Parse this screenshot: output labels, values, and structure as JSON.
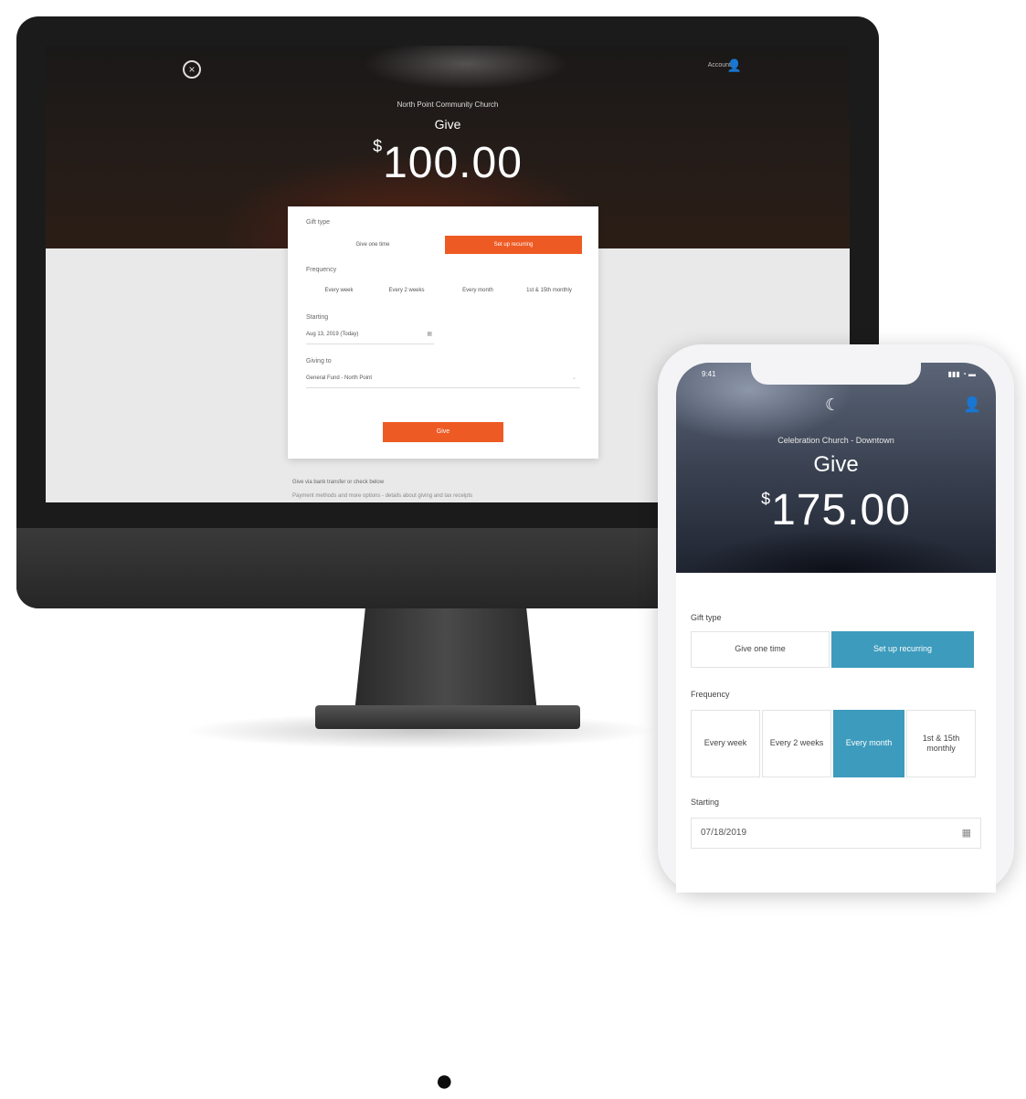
{
  "desktop": {
    "close_icon": "close-icon",
    "login_label": "Account",
    "church_name": "North Point Community Church",
    "give_title": "Give",
    "currency": "$",
    "amount": "100.00",
    "gift_type_label": "Gift type",
    "gift_type_options": [
      "Give one time",
      "Set up recurring"
    ],
    "frequency_label": "Frequency",
    "frequency_options": [
      "Every week",
      "Every 2 weeks",
      "Every month",
      "1st & 15th monthly"
    ],
    "starting_label": "Starting",
    "starting_value": "Aug 13, 2019 (Today)",
    "giving_to_label": "Giving to",
    "giving_to_value": "General Fund - North Point",
    "give_button": "Give",
    "footer_line1": "Give via bank transfer or check below",
    "footer_line2": "Payment methods and more options - details about giving and tax receipts",
    "accent_color": "#ee5a24"
  },
  "mobile": {
    "time": "9:41",
    "status": "▮▮▮ ◔ ▬",
    "church_name": "Celebration Church - Downtown",
    "give_title": "Give",
    "currency": "$",
    "amount": "175.00",
    "gift_type_label": "Gift type",
    "gift_type_options": [
      "Give one time",
      "Set up recurring"
    ],
    "frequency_label": "Frequency",
    "frequency_options": [
      "Every week",
      "Every 2 weeks",
      "Every month",
      "1st & 15th monthly"
    ],
    "starting_label": "Starting",
    "starting_value": "07/18/2019",
    "accent_color": "#3d9bbd"
  }
}
